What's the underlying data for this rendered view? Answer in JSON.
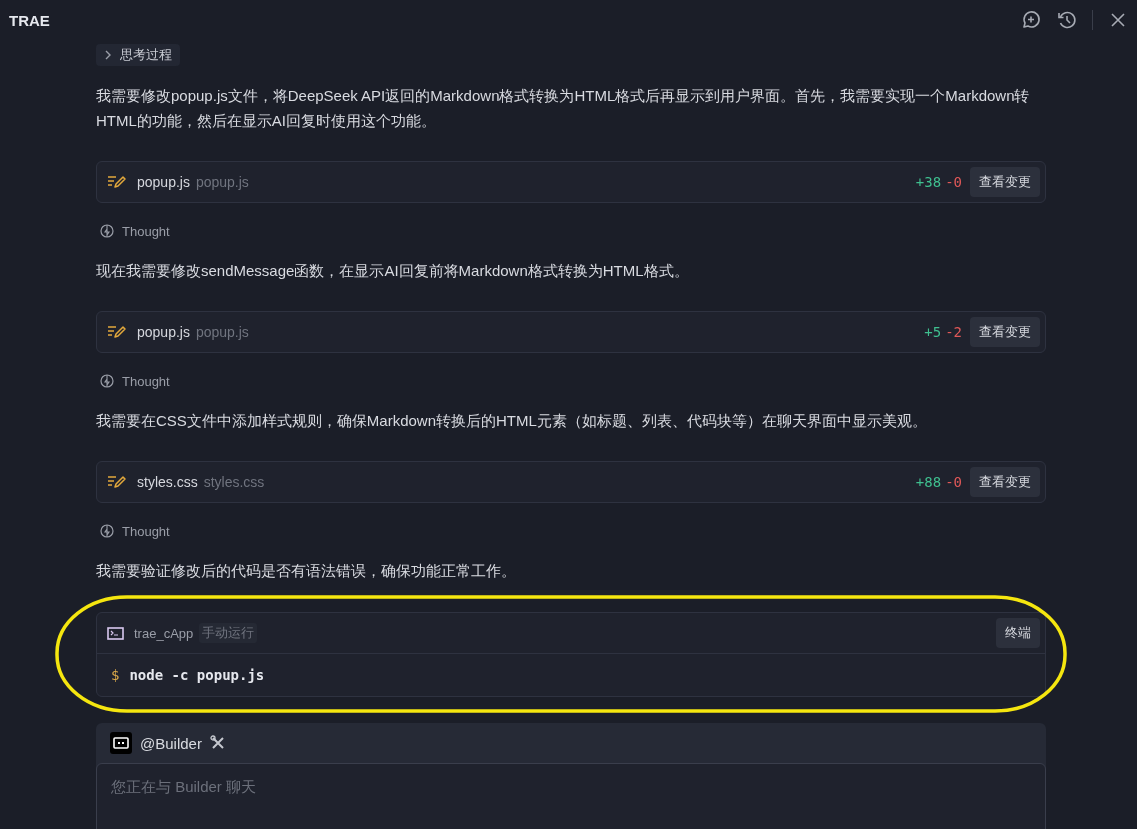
{
  "window": {
    "title": "TRAE"
  },
  "items": [
    {
      "kind": "toggle",
      "label": "思考过程",
      "expanded": false
    },
    {
      "kind": "paragraph",
      "text": "我需要修改popup.js文件，将DeepSeek API返回的Markdown格式转换为HTML格式后再显示到用户界面。首先，我需要实现一个Markdown转HTML的功能，然后在显示AI回复时使用这个功能。"
    },
    {
      "kind": "file_edit",
      "name": "popup.js",
      "path": "popup.js",
      "added": "+38",
      "removed": "-0",
      "button": "查看变更"
    },
    {
      "kind": "thought",
      "label": "Thought"
    },
    {
      "kind": "paragraph",
      "text": "现在我需要修改sendMessage函数，在显示AI回复前将Markdown格式转换为HTML格式。"
    },
    {
      "kind": "file_edit",
      "name": "popup.js",
      "path": "popup.js",
      "added": "+5",
      "removed": "-2",
      "button": "查看变更"
    },
    {
      "kind": "thought",
      "label": "Thought"
    },
    {
      "kind": "paragraph",
      "text": "我需要在CSS文件中添加样式规则，确保Markdown转换后的HTML元素（如标题、列表、代码块等）在聊天界面中显示美观。"
    },
    {
      "kind": "file_edit",
      "name": "styles.css",
      "path": "styles.css",
      "added": "+88",
      "removed": "-0",
      "button": "查看变更"
    },
    {
      "kind": "thought",
      "label": "Thought"
    },
    {
      "kind": "paragraph",
      "text": "我需要验证修改后的代码是否有语法错误，确保功能正常工作。"
    },
    {
      "kind": "terminal",
      "name": "trae_cApp",
      "tag": "手动运行",
      "button": "终端",
      "prompt": "$",
      "command": "node -c popup.js",
      "highlighted": true
    }
  ],
  "composer": {
    "agent": "@Builder",
    "placeholder": "您正在与 Builder 聊天"
  }
}
